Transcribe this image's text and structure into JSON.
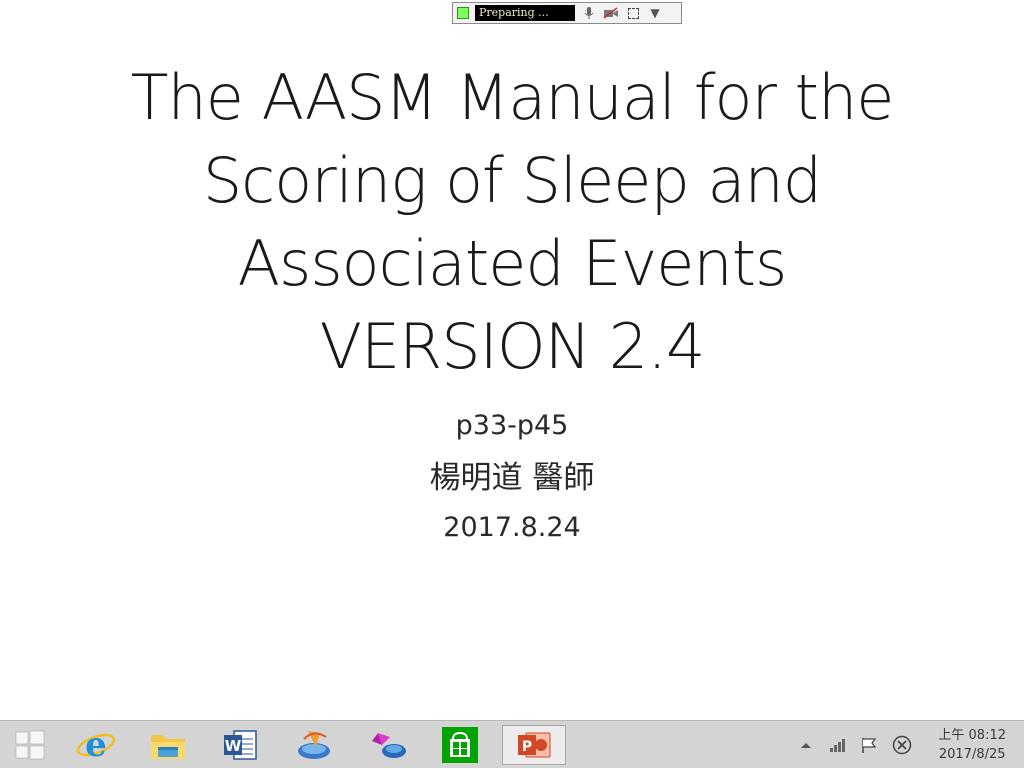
{
  "recorder": {
    "status": "Preparing ..."
  },
  "slide": {
    "title_lines": [
      "The AASM Manual for the",
      "Scoring of Sleep and",
      "Associated Events",
      "VERSION 2.4"
    ],
    "pages": "p33-p45",
    "author": "楊明道 醫師",
    "date": "2017.8.24"
  },
  "taskbar": {
    "apps": [
      {
        "name": "start-button-icon"
      },
      {
        "name": "internet-explorer-icon"
      },
      {
        "name": "file-explorer-icon"
      },
      {
        "name": "microsoft-word-icon"
      },
      {
        "name": "media-app-icon"
      },
      {
        "name": "cube-app-icon"
      },
      {
        "name": "windows-store-icon"
      },
      {
        "name": "powerpoint-icon"
      }
    ],
    "clock": {
      "time": "上午 08:12",
      "date": "2017/8/25"
    }
  }
}
